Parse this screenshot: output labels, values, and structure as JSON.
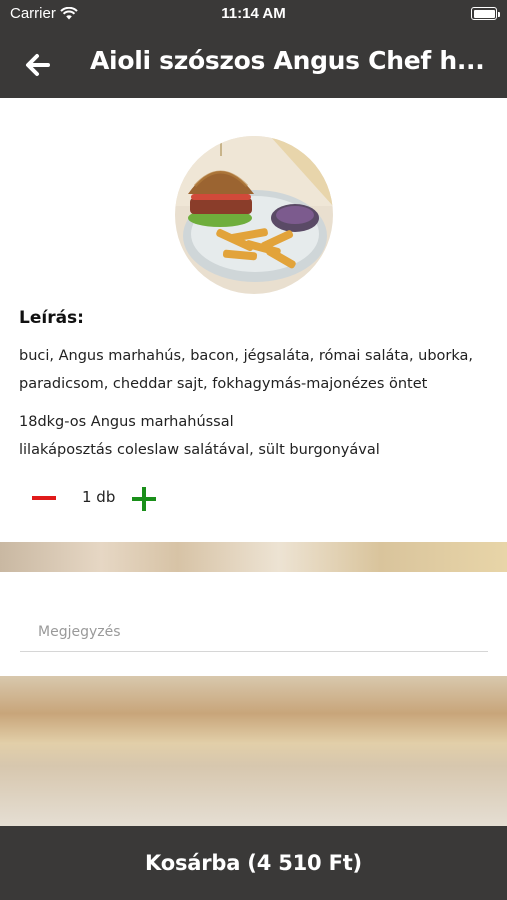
{
  "status_bar": {
    "carrier": "Carrier",
    "time": "11:14 AM"
  },
  "header": {
    "title": "Aioli szószos Angus Chef h..."
  },
  "product": {
    "description_heading": "Leírás:",
    "description_line1": "buci, Angus marhahús, bacon, jégsaláta, római saláta, uborka,",
    "description_line2": "paradicsom, cheddar sajt, fokhagymás-majonézes öntet",
    "extra_line1": "18dkg-os Angus marhahússal",
    "extra_line2": "lilakáposztás coleslaw salátával, sült burgonyával",
    "quantity_label": "1 db"
  },
  "note": {
    "placeholder": "Megjegyzés",
    "value": ""
  },
  "footer": {
    "cart_button_label": "Kosárba (4 510 Ft)"
  },
  "colors": {
    "header_bg": "#3a3938",
    "minus": "#e01a1a",
    "plus": "#1a8f1a"
  },
  "icons": {
    "back": "arrow-left-icon",
    "wifi": "wifi-icon",
    "battery": "battery-icon",
    "minus": "minus-icon",
    "plus": "plus-icon"
  }
}
